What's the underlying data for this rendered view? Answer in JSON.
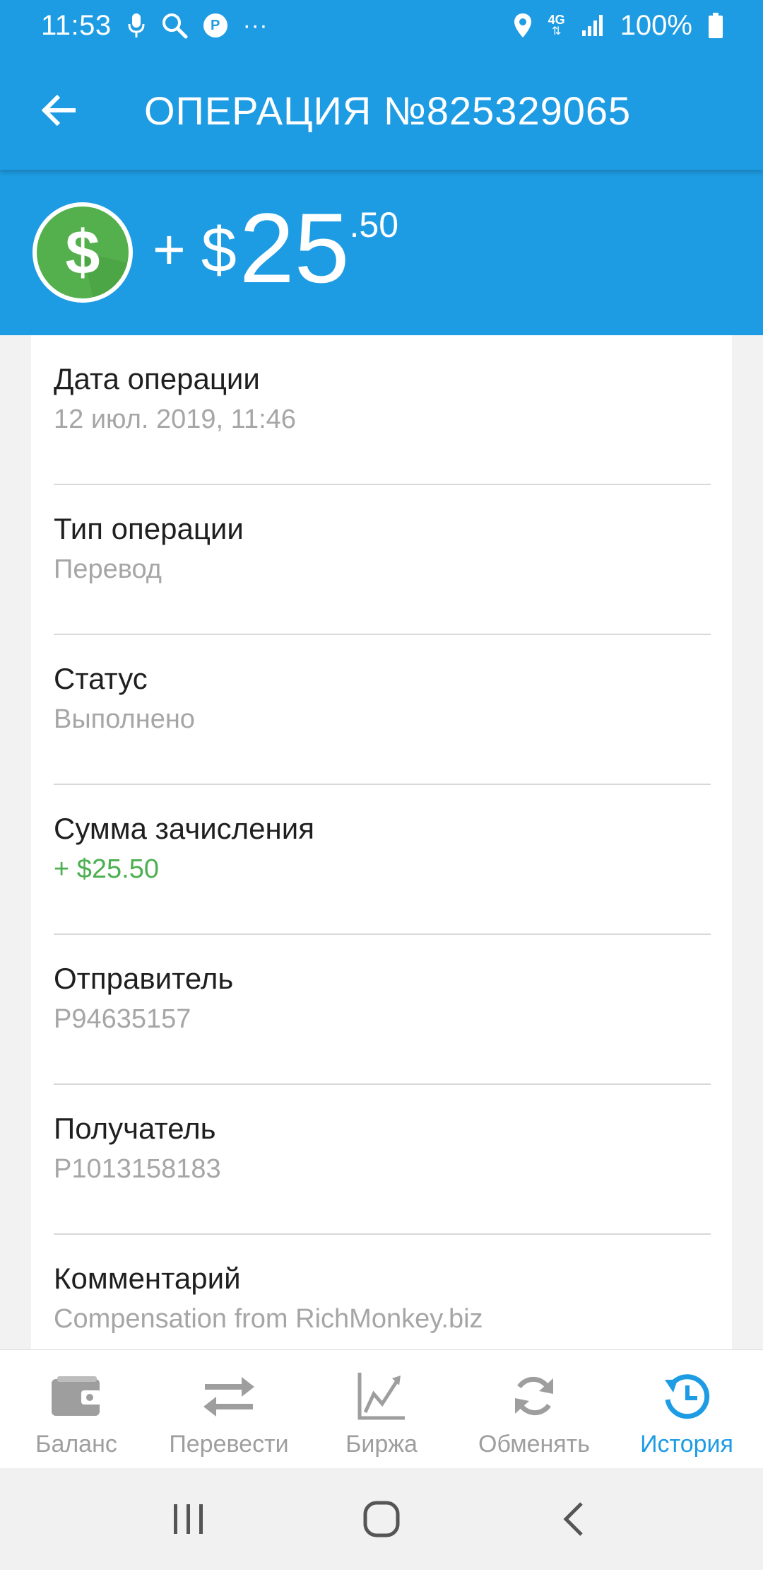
{
  "status_bar": {
    "time": "11:53",
    "p_badge": "P",
    "more": "···",
    "network": "4G",
    "battery": "100%"
  },
  "app_bar": {
    "title": "ОПЕРАЦИЯ №825329065"
  },
  "amount": {
    "sign": "+",
    "currency": "$",
    "main": "25",
    "cents": ".50",
    "coin_symbol": "$"
  },
  "details": [
    {
      "label": "Дата операции",
      "value": "12 июл. 2019, 11:46"
    },
    {
      "label": "Тип операции",
      "value": "Перевод"
    },
    {
      "label": "Статус",
      "value": "Выполнено"
    },
    {
      "label": "Сумма зачисления",
      "value": "+ $25.50"
    },
    {
      "label": "Отправитель",
      "value": "P94635157"
    },
    {
      "label": "Получатель",
      "value": "P1013158183"
    },
    {
      "label": "Комментарий",
      "value": "Compensation from RichMonkey.biz"
    }
  ],
  "bottom_nav": [
    {
      "label": "Баланс",
      "icon": "wallet-icon"
    },
    {
      "label": "Перевести",
      "icon": "transfer-arrows-icon"
    },
    {
      "label": "Биржа",
      "icon": "chart-icon"
    },
    {
      "label": "Обменять",
      "icon": "refresh-icon"
    },
    {
      "label": "История",
      "icon": "history-icon",
      "active": true
    }
  ],
  "colors": {
    "primary": "#1e9ce3",
    "green": "#4caf50",
    "inactive": "#9e9e9e"
  }
}
